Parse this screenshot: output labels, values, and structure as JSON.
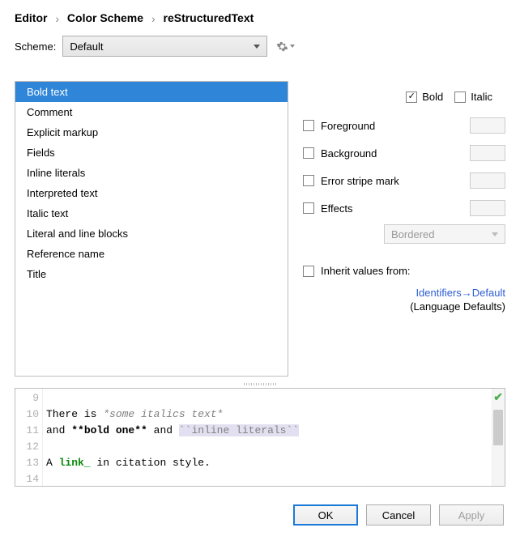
{
  "breadcrumb": [
    "Editor",
    "Color Scheme",
    "reStructuredText"
  ],
  "scheme_label": "Scheme:",
  "scheme_value": "Default",
  "list_items": [
    "Bold text",
    "Comment",
    "Explicit markup",
    "Fields",
    "Inline literals",
    "Interpreted text",
    "Italic text",
    "Literal and line blocks",
    "Reference name",
    "Title"
  ],
  "selected_index": 0,
  "font_options": {
    "bold": {
      "label": "Bold",
      "checked": true
    },
    "italic": {
      "label": "Italic",
      "checked": false
    }
  },
  "props": {
    "foreground": {
      "label": "Foreground",
      "checked": false
    },
    "background": {
      "label": "Background",
      "checked": false
    },
    "error_stripe": {
      "label": "Error stripe mark",
      "checked": false
    },
    "effects": {
      "label": "Effects",
      "checked": false
    }
  },
  "effects_select": "Bordered",
  "inherit": {
    "label": "Inherit values from:",
    "link": "Identifiers→Default",
    "sub": "(Language Defaults)"
  },
  "preview": {
    "line_nos": [
      "9",
      "10",
      "11",
      "12",
      "13",
      "14"
    ],
    "line10_prefix": "There is ",
    "line10_italic": "*some italics text*",
    "line11_prefix": "and ",
    "line11_bold": "**bold one**",
    "line11_mid": " and ",
    "line11_literal": "``inline literals``",
    "line13_prefix": "A ",
    "line13_link": "link_",
    "line13_suffix": " in citation style."
  },
  "buttons": {
    "ok": "OK",
    "cancel": "Cancel",
    "apply": "Apply"
  }
}
